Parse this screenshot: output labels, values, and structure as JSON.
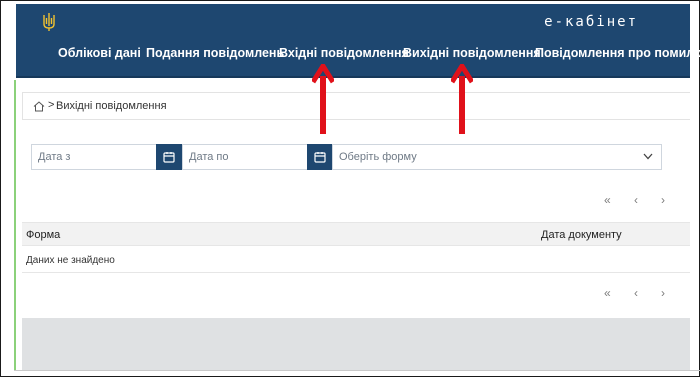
{
  "header": {
    "brand": "е-кабінет",
    "emblem_icon": "trident-icon",
    "nav": [
      "Облікові дані",
      "Подання повідомлень",
      "Вхідні повідомлення",
      "Вихідні повідомлення",
      "Повідомлення про помилку"
    ]
  },
  "breadcrumb": {
    "home_icon": "home-icon",
    "separator": ">",
    "current": "Вихідні повідомлення"
  },
  "filters": {
    "date_from_placeholder": "Дата з",
    "date_to_placeholder": "Дата по",
    "form_select_placeholder": "Оберіть форму",
    "calendar_icon": "calendar-icon"
  },
  "pagination": {
    "first": "«",
    "prev": "‹",
    "next": "›"
  },
  "table": {
    "columns": [
      "Форма",
      "Дата документу"
    ],
    "empty_message": "Даних не знайдено"
  },
  "colors": {
    "header_bg": "#1e4770",
    "annotation_arrows": "#e0111a",
    "accent_green": "#8bd17a"
  }
}
